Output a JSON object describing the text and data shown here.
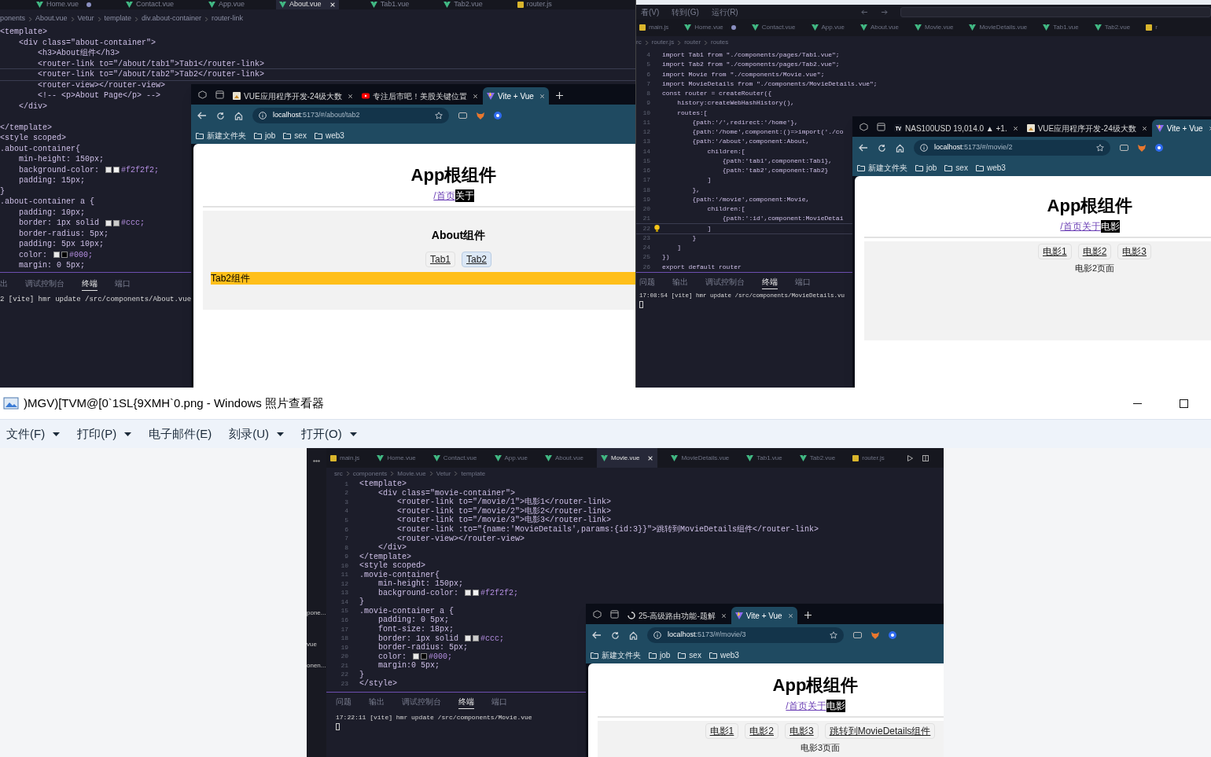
{
  "top_left_editor": {
    "tabs": [
      {
        "label": "Home.vue",
        "kind": "vue",
        "selected": false,
        "modified": true
      },
      {
        "label": "Contact.vue",
        "kind": "vue",
        "selected": false,
        "modified": false
      },
      {
        "label": "App.vue",
        "kind": "vue",
        "selected": false,
        "modified": false
      },
      {
        "label": "About.vue",
        "kind": "vue",
        "selected": true,
        "modified": false
      },
      {
        "label": "Tab1.vue",
        "kind": "vue",
        "selected": false,
        "modified": false
      },
      {
        "label": "Tab2.vue",
        "kind": "vue",
        "selected": false,
        "modified": false
      },
      {
        "label": "router.js",
        "kind": "js",
        "selected": false,
        "modified": false
      }
    ],
    "breadcrumb": [
      "ponents",
      "About.vue",
      "Vetur",
      "template",
      "div.about-container",
      "router-link"
    ],
    "lines": [
      {
        "kind": "code",
        "text": "<template>",
        "hint": false
      },
      {
        "kind": "code",
        "text": "    <div class=\"about-container\">",
        "hint": false
      },
      {
        "kind": "code",
        "text": "        <h3>About组件</h3>",
        "hint": false
      },
      {
        "kind": "code",
        "text": "        <router-link to=\"/about/tab1\">Tab1</router-link>",
        "hint": false
      },
      {
        "kind": "code",
        "text": "        <router-link to=\"/about/tab2\">Tab2</router-link>",
        "hint": true
      },
      {
        "kind": "code",
        "text": "        <router-view></router-view>",
        "hint": false
      },
      {
        "kind": "code",
        "text": "        <!-- <p>About Page</p> -->",
        "hint": false
      },
      {
        "kind": "code",
        "text": "    </div>",
        "hint": false
      },
      {
        "kind": "blank",
        "hint": false
      },
      {
        "kind": "code",
        "text": "</template>",
        "hint": false
      },
      {
        "kind": "code",
        "text": "<style scoped>",
        "hint": false
      },
      {
        "kind": "code",
        "text": ".about-container{",
        "hint": false
      },
      {
        "kind": "code",
        "text": "    min-height: 150px;",
        "hint": false
      },
      {
        "kind": "swatch",
        "text": "    background-color: ",
        "color": "#f2f2f2",
        "after": "#f2f2f2;",
        "hint": false
      },
      {
        "kind": "code",
        "text": "    padding: 15px;",
        "hint": false
      },
      {
        "kind": "code",
        "text": "}",
        "hint": false
      },
      {
        "kind": "code",
        "text": ".about-container a {",
        "hint": false
      },
      {
        "kind": "code",
        "text": "    padding: 10px;",
        "hint": false
      },
      {
        "kind": "swatch",
        "text": "    border: 1px solid ",
        "color": "#cccccc",
        "after": "#ccc;",
        "hint": false
      },
      {
        "kind": "code",
        "text": "    border-radius: 5px;",
        "hint": false
      },
      {
        "kind": "code",
        "text": "    padding: 5px 10px;",
        "hint": false
      },
      {
        "kind": "swatch",
        "text": "    color: ",
        "color": "#000000",
        "after": "#000;",
        "hint": false
      },
      {
        "kind": "code",
        "text": "    margin: 0 5px;",
        "hint": false
      }
    ],
    "panel_tabs": [
      {
        "label": "出",
        "selected": false
      },
      {
        "label": "调试控制台",
        "selected": false
      },
      {
        "label": "终端",
        "selected": true
      },
      {
        "label": "端口",
        "selected": false
      }
    ],
    "terminal": "2 [vite] hmr update /src/components/About.vue"
  },
  "browser_about": {
    "tabs": [
      {
        "label": "VUE应用程序开发-24级大数",
        "kind": "image",
        "selected": false
      },
      {
        "label": "专注后市吧！美股关键位置",
        "kind": "video",
        "selected": false
      },
      {
        "label": "Vite + Vue",
        "kind": "vite",
        "selected": true
      }
    ],
    "url": "**localhost**:5173/#/about/tab2",
    "bookmarks": [
      "新建文件夹",
      "job",
      "sex",
      "web3"
    ],
    "page": {
      "title": "App根组件",
      "nav": [
        {
          "label": "/首页",
          "selected": false
        },
        {
          "label": "关于",
          "selected": true
        }
      ],
      "section": {
        "heading": "About组件",
        "links": [
          {
            "label": "Tab1",
            "selected": false
          },
          {
            "label": "Tab2",
            "selected": true
          }
        ],
        "output": {
          "kind": "highlight",
          "text": "Tab2组件"
        }
      }
    }
  },
  "top_right_editor": {
    "menu": [
      "看(V)",
      "转到(G)",
      "运行(R)"
    ],
    "tabs": [
      {
        "label": "main.js",
        "kind": "js",
        "selected": false,
        "modified": false
      },
      {
        "label": "Home.vue",
        "kind": "vue",
        "selected": false,
        "modified": true
      },
      {
        "label": "Contact.vue",
        "kind": "vue",
        "selected": false,
        "modified": false
      },
      {
        "label": "App.vue",
        "kind": "vue",
        "selected": false,
        "modified": false
      },
      {
        "label": "About.vue",
        "kind": "vue",
        "selected": false,
        "modified": false
      },
      {
        "label": "Movie.vue",
        "kind": "vue",
        "selected": false,
        "modified": false
      },
      {
        "label": "MovieDetails.vue",
        "kind": "vue",
        "selected": false,
        "modified": false
      },
      {
        "label": "Tab1.vue",
        "kind": "vue",
        "selected": false,
        "modified": false
      },
      {
        "label": "Tab2.vue",
        "kind": "vue",
        "selected": false,
        "modified": false
      },
      {
        "label": "r",
        "kind": "js",
        "selected": false,
        "modified": false
      }
    ],
    "breadcrumb": [
      "rc",
      "router.js",
      "router",
      "routes"
    ],
    "lines": [
      {
        "kind": "code",
        "n": "4",
        "text": "import Tab1 from \"./components/pages/Tab1.vue\";",
        "hint": false
      },
      {
        "kind": "code",
        "n": "5",
        "text": "import Tab2 from \"./components/pages/Tab2.vue\";",
        "hint": false
      },
      {
        "kind": "code",
        "n": "6",
        "text": "import Movie from \"./components/Movie.vue\";",
        "hint": false
      },
      {
        "kind": "code",
        "n": "7",
        "text": "import MovieDetails from \"./components/MovieDetails.vue\";",
        "hint": false
      },
      {
        "kind": "code",
        "n": "8",
        "text": "const router = createRouter({",
        "hint": false
      },
      {
        "kind": "code",
        "n": "9",
        "text": "    history:createWebHashHistory(),",
        "hint": false
      },
      {
        "kind": "code",
        "n": "10",
        "text": "    routes:[",
        "hint": false
      },
      {
        "kind": "code",
        "n": "11",
        "text": "        {path:'/',redirect:'/home'},",
        "hint": false
      },
      {
        "kind": "code",
        "n": "12",
        "text": "        {path:'/home',component:()=>import('./co",
        "hint": false
      },
      {
        "kind": "code",
        "n": "13",
        "text": "        {path:'/about',component:About,",
        "hint": false
      },
      {
        "kind": "code",
        "n": "14",
        "text": "            children:[",
        "hint": false
      },
      {
        "kind": "code",
        "n": "15",
        "text": "                {path:'tab1',component:Tab1},",
        "hint": false
      },
      {
        "kind": "code",
        "n": "16",
        "text": "                {path:'tab2',component:Tab2}",
        "hint": false
      },
      {
        "kind": "code",
        "n": "17",
        "text": "            ]",
        "hint": false
      },
      {
        "kind": "code",
        "n": "18",
        "text": "        },",
        "hint": false
      },
      {
        "kind": "code",
        "n": "19",
        "text": "        {path:'/movie',component:Movie,",
        "hint": false
      },
      {
        "kind": "code",
        "n": "20",
        "text": "            children:[",
        "hint": false
      },
      {
        "kind": "code",
        "n": "21",
        "text": "                {path:':id',component:MovieDetai",
        "hint": false
      },
      {
        "kind": "code",
        "n": "22",
        "text": "            ]",
        "hint": true
      },
      {
        "kind": "code",
        "n": "23",
        "text": "        }",
        "hint": false
      },
      {
        "kind": "code",
        "n": "24",
        "text": "    ]",
        "hint": false
      },
      {
        "kind": "code",
        "n": "25",
        "text": "})",
        "hint": false
      },
      {
        "kind": "code",
        "n": "26",
        "text": "export default router",
        "hint": false
      }
    ],
    "panel_tabs": [
      {
        "label": "问题",
        "selected": false
      },
      {
        "label": "输出",
        "selected": false
      },
      {
        "label": "调试控制台",
        "selected": false
      },
      {
        "label": "终端",
        "selected": true
      },
      {
        "label": "端口",
        "selected": false
      }
    ],
    "terminal": "17:08:54 [vite] hmr update /src/components/MovieDetails.vu"
  },
  "browser_movie": {
    "tabs": [
      {
        "label": "NAS100USD 19,014.0 ▲ +1.",
        "kind": "chart",
        "selected": false
      },
      {
        "label": "VUE应用程序开发-24级大数",
        "kind": "image",
        "selected": false
      },
      {
        "label": "Vite + Vue",
        "kind": "vite",
        "selected": true
      }
    ],
    "url": "**localhost**:5173/#/movie/2",
    "bookmarks": [
      "新建文件夹",
      "job",
      "sex",
      "web3"
    ],
    "page": {
      "title": "App根组件",
      "nav": [
        {
          "label": "/首页",
          "selected": false
        },
        {
          "label": "关于",
          "selected": false
        },
        {
          "label": "电影",
          "selected": true
        }
      ],
      "section": {
        "links": [
          {
            "label": "电影1",
            "selected": false
          },
          {
            "label": "电影2",
            "selected": false
          },
          {
            "label": "电影3",
            "selected": false
          }
        ],
        "output": {
          "kind": "text",
          "text": "电影2页面"
        }
      }
    }
  },
  "photo_viewer": {
    "title": ")MGV)[TVM@[0`1SL{9XMH`0.png - Windows 照片查看器",
    "menu": [
      {
        "label": "文件(F)",
        "dropdown": true
      },
      {
        "label": "打印(P)",
        "dropdown": true
      },
      {
        "label": "电子邮件(E)",
        "dropdown": false
      },
      {
        "label": "刻录(U)",
        "dropdown": true
      },
      {
        "label": "打开(O)",
        "dropdown": true
      }
    ],
    "image": {
      "editor": {
        "explorer": [
          "pone...",
          "vue",
          "onen..."
        ],
        "tabs": [
          {
            "label": "main.js",
            "kind": "js",
            "selected": false,
            "modified": false
          },
          {
            "label": "Home.vue",
            "kind": "vue",
            "selected": false,
            "modified": false
          },
          {
            "label": "Contact.vue",
            "kind": "vue",
            "selected": false,
            "modified": false
          },
          {
            "label": "App.vue",
            "kind": "vue",
            "selected": false,
            "modified": false
          },
          {
            "label": "About.vue",
            "kind": "vue",
            "selected": false,
            "modified": false
          },
          {
            "label": "Movie.vue",
            "kind": "vue",
            "selected": true,
            "modified": false
          },
          {
            "label": "MovieDetails.vue",
            "kind": "vue",
            "selected": false,
            "modified": false
          },
          {
            "label": "Tab1.vue",
            "kind": "vue",
            "selected": false,
            "modified": false
          },
          {
            "label": "Tab2.vue",
            "kind": "vue",
            "selected": false,
            "modified": false
          },
          {
            "label": "router.js",
            "kind": "js",
            "selected": false,
            "modified": false
          }
        ],
        "breadcrumb": [
          "src",
          "components",
          "Movie.vue",
          "Vetur",
          "template"
        ],
        "lines": [
          {
            "kind": "code",
            "n": "1",
            "text": "<template>",
            "hint": false
          },
          {
            "kind": "code",
            "n": "2",
            "text": "    <div class=\"movie-container\">",
            "hint": false
          },
          {
            "kind": "code",
            "n": "3",
            "text": "        <router-link to=\"/movie/1\">电影1</router-link>",
            "hint": false
          },
          {
            "kind": "code",
            "n": "4",
            "text": "        <router-link to=\"/movie/2\">电影2</router-link>",
            "hint": false
          },
          {
            "kind": "code",
            "n": "5",
            "text": "        <router-link to=\"/movie/3\">电影3</router-link>",
            "hint": false
          },
          {
            "kind": "code",
            "n": "6",
            "text": "        <router-link :to=\"{name:'MovieDetails',params:{id:3}}\">跳转到MovieDetails组件</router-link>",
            "hint": false
          },
          {
            "kind": "code",
            "n": "7",
            "text": "        <router-view></router-view>",
            "hint": false
          },
          {
            "kind": "code",
            "n": "8",
            "text": "    </div>",
            "hint": false
          },
          {
            "kind": "code",
            "n": "9",
            "text": "</template>",
            "hint": false
          },
          {
            "kind": "code",
            "n": "10",
            "text": "<style scoped>",
            "hint": false
          },
          {
            "kind": "code",
            "n": "11",
            "text": ".movie-container{",
            "hint": false
          },
          {
            "kind": "code",
            "n": "12",
            "text": "    min-height: 150px;",
            "hint": false
          },
          {
            "kind": "swatch",
            "n": "13",
            "text": "    background-color: ",
            "color": "#f2f2f2",
            "after": "#f2f2f2;",
            "hint": false
          },
          {
            "kind": "code",
            "n": "14",
            "text": "}",
            "hint": false
          },
          {
            "kind": "code",
            "n": "15",
            "text": ".movie-container a {",
            "hint": false
          },
          {
            "kind": "code",
            "n": "16",
            "text": "    padding: 0 5px;",
            "hint": false
          },
          {
            "kind": "code",
            "n": "17",
            "text": "    font-size: 18px;",
            "hint": false
          },
          {
            "kind": "swatch",
            "n": "18",
            "text": "    border: 1px solid ",
            "color": "#cccccc",
            "after": "#ccc;",
            "hint": false
          },
          {
            "kind": "code",
            "n": "19",
            "text": "    border-radius: 5px;",
            "hint": false
          },
          {
            "kind": "swatch",
            "n": "20",
            "text": "    color: ",
            "color": "#000000",
            "after": "#000;",
            "hint": false
          },
          {
            "kind": "code",
            "n": "21",
            "text": "    margin:0 5px;",
            "hint": false
          },
          {
            "kind": "code",
            "n": "22",
            "text": "}",
            "hint": false
          },
          {
            "kind": "code",
            "n": "23",
            "text": "</style>",
            "hint": false
          }
        ],
        "panel_tabs": [
          {
            "label": "问题",
            "selected": false
          },
          {
            "label": "输出",
            "selected": false
          },
          {
            "label": "调试控制台",
            "selected": false
          },
          {
            "label": "终端",
            "selected": true
          },
          {
            "label": "端口",
            "selected": false
          }
        ],
        "terminal": "17:22:11 [vite] hmr update /src/components/Movie.vue"
      },
      "browser": {
        "tabs": [
          {
            "label": "25-高级路由功能-题解",
            "kind": "loading",
            "selected": false
          },
          {
            "label": "Vite + Vue",
            "kind": "vite",
            "selected": true
          }
        ],
        "url": "**localhost**:5173/#/movie/3",
        "bookmarks": [
          "新建文件夹",
          "job",
          "sex",
          "web3"
        ],
        "page": {
          "title": "App根组件",
          "nav": [
            {
              "label": "/首页",
              "selected": false
            },
            {
              "label": "关于",
              "selected": false
            },
            {
              "label": "电影",
              "selected": true
            }
          ],
          "section": {
            "links": [
              {
                "label": "电影1",
                "selected": false
              },
              {
                "label": "电影2",
                "selected": false
              },
              {
                "label": "电影3",
                "selected": false
              },
              {
                "label": "跳转到MovieDetails组件",
                "selected": false
              }
            ],
            "output": {
              "kind": "text",
              "text": "电影3页面"
            }
          }
        }
      }
    }
  }
}
